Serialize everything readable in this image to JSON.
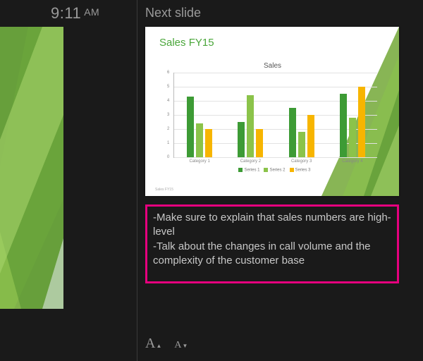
{
  "clock": {
    "time": "9:11",
    "ampm": "AM"
  },
  "next_label": "Next slide",
  "slide": {
    "title": "Sales FY15",
    "footnote": "Sales FY15"
  },
  "chart_data": {
    "type": "bar",
    "title": "Sales",
    "xlabel": "",
    "ylabel": "",
    "ylim": [
      0,
      6
    ],
    "yticks": [
      0,
      1,
      2,
      3,
      4,
      5,
      6
    ],
    "categories": [
      "Category 1",
      "Category 2",
      "Category 3",
      "Category 4"
    ],
    "series": [
      {
        "name": "Series 1",
        "values": [
          4.3,
          2.5,
          3.5,
          4.5
        ],
        "color": "#3d9b35"
      },
      {
        "name": "Series 2",
        "values": [
          2.4,
          4.4,
          1.8,
          2.8
        ],
        "color": "#8bc34a"
      },
      {
        "name": "Series 3",
        "values": [
          2.0,
          2.0,
          3.0,
          5.0
        ],
        "color": "#f7b500"
      }
    ]
  },
  "notes": {
    "lines": [
      "-Make sure to explain that sales numbers are high-level",
      "-Talk about the changes in call volume and the complexity of the customer base"
    ]
  },
  "font_controls": {
    "increase": "A",
    "decrease": "A"
  },
  "colors": {
    "accent": "#4aa63a",
    "highlight_border": "#e6007e"
  }
}
